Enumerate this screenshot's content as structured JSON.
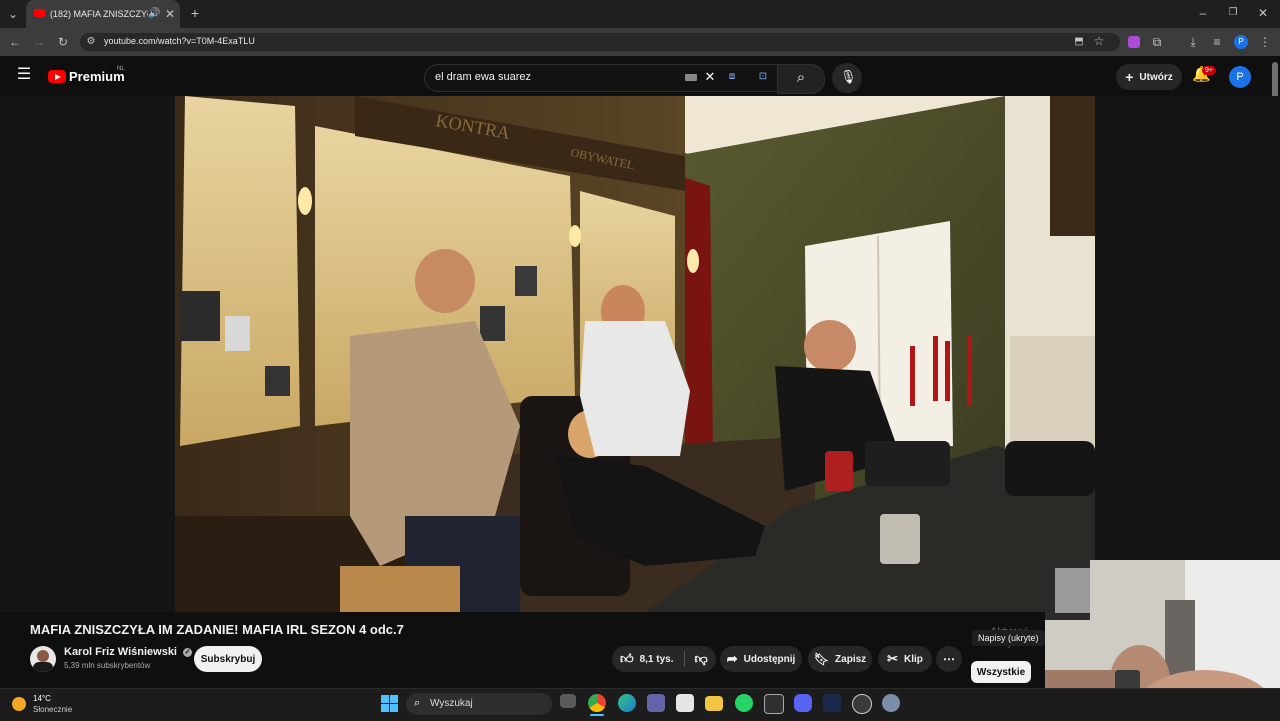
{
  "browser": {
    "tab_title": "(182) MAFIA ZNISZCZYŁA I",
    "url": "youtube.com/watch?v=T0M-4ExaTLU",
    "profile_initial": "P"
  },
  "youtube": {
    "logo_text": "Premium",
    "region": "NL",
    "search_value": "el dram ewa suarez",
    "create_label": "Utwórz",
    "notifications_badge": "9+",
    "avatar_initial": "P"
  },
  "video_frame": {
    "sign_kontra": "KONTRA",
    "sign_obywatel": "OBYWATEL"
  },
  "video": {
    "title": "MAFIA ZNISZCZYŁA IM ZADANIE! MAFIA IRL SEZON 4 odc.7",
    "channel_name": "Karol Friz Wiśniewski",
    "subscribers": "5,39 mln subskrybentów",
    "subscribe_label": "Subskrybuj",
    "likes": "8,1 tys.",
    "share_label": "Udostępnij",
    "save_label": "Zapisz",
    "clip_label": "Klip",
    "more_label": "⋯"
  },
  "sidebar": {
    "subtitles_label": "Napisy (ukryte)",
    "filter_all": "Wszystkie",
    "activation_line1": "Aktywuj",
    "activation_line2": "Przejdź do u"
  },
  "taskbar": {
    "weather_temp": "14°C",
    "weather_desc": "Słonecznie",
    "search_placeholder": "Wyszukaj"
  },
  "colors": {
    "youtube_red": "#ff0000",
    "taskbar_bg": "#1c1c1c",
    "page_bg": "#0f0f0f",
    "avatar_blue": "#1a73e8"
  }
}
